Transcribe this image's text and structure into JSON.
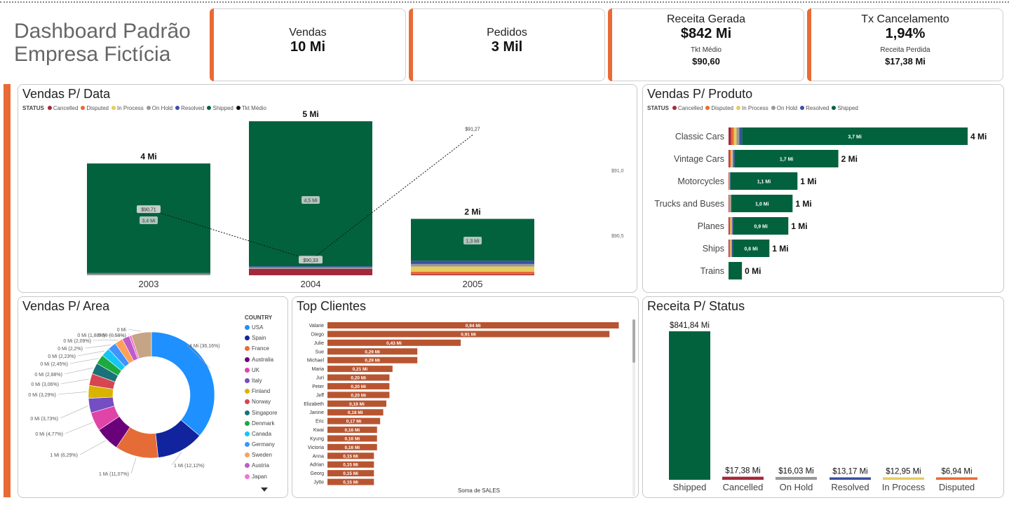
{
  "header": {
    "title_line1": "Dashboard Padrão",
    "title_line2": "Empresa Fictícia"
  },
  "kpis": {
    "vendas": {
      "label": "Vendas",
      "value": "10 Mi"
    },
    "pedidos": {
      "label": "Pedidos",
      "value": "3 Mil"
    },
    "receita": {
      "label": "Receita Gerada",
      "value": "$842 Mi",
      "sub_label": "Tkt Médio",
      "sub_value": "$90,60"
    },
    "cancel": {
      "label": "Tx Cancelamento",
      "value": "1,94%",
      "sub_label": "Receita Perdida",
      "sub_value": "$17,38 Mi"
    }
  },
  "colors": {
    "accent": "#e96a35",
    "Cancelled": "#a4283b",
    "Disputed": "#e96a35",
    "In Process": "#e6cc5c",
    "On Hold": "#999999",
    "Resolved": "#3a50a4",
    "Shipped": "#03623e",
    "Tkt Médio": "#111111",
    "clientes_bar": "#b85531"
  },
  "legend_status": {
    "title": "STATUS",
    "items": [
      "Cancelled",
      "Disputed",
      "In Process",
      "On Hold",
      "Resolved",
      "Shipped",
      "Tkt Médio"
    ]
  },
  "chart_data": [
    {
      "id": "vendas_data",
      "type": "bar",
      "title": "Vendas P/ Data",
      "categories": [
        "2003",
        "2004",
        "2005"
      ],
      "totals_labels": [
        "4 Mi",
        "5 Mi",
        "2 Mi"
      ],
      "shipped_labels": [
        "3,4 Mi",
        "4,5 Mi",
        "1,3 Mi"
      ],
      "stacked": true,
      "series": [
        {
          "name": "Cancelled",
          "values": [
            0.0,
            0.2,
            0.03
          ]
        },
        {
          "name": "Disputed",
          "values": [
            0.0,
            0.0,
            0.08
          ]
        },
        {
          "name": "In Process",
          "values": [
            0.0,
            0.0,
            0.16
          ]
        },
        {
          "name": "On Hold",
          "values": [
            0.05,
            0.05,
            0.08
          ]
        },
        {
          "name": "Resolved",
          "values": [
            0.02,
            0.03,
            0.1
          ]
        },
        {
          "name": "Shipped",
          "values": [
            3.4,
            4.5,
            1.3
          ]
        }
      ],
      "line": {
        "name": "Tkt Médio",
        "values": [
          90.71,
          90.33,
          91.27
        ],
        "labels": [
          "$90,71",
          "$90,33",
          "$91,27"
        ]
      },
      "y2_ticks": [
        "$91,0",
        "$90,5"
      ]
    },
    {
      "id": "vendas_produto",
      "type": "bar",
      "orientation": "horizontal",
      "title": "Vendas P/ Produto",
      "categories": [
        "Classic Cars",
        "Vintage Cars",
        "Motorcycles",
        "Trucks and Buses",
        "Planes",
        "Ships",
        "Trains"
      ],
      "totals_labels": [
        "4 Mi",
        "2 Mi",
        "1 Mi",
        "1 Mi",
        "1 Mi",
        "1 Mi",
        "0 Mi"
      ],
      "shipped_values": [
        3.7,
        1.7,
        1.1,
        1.0,
        0.9,
        0.6,
        0.22
      ],
      "shipped_labels": [
        "3,7 Mi",
        "1,7 Mi",
        "1,1 Mi",
        "1,0 Mi",
        "0,9 Mi",
        "0,6 Mi",
        ""
      ],
      "other_values": [
        0.22,
        0.1,
        0.03,
        0.05,
        0.08,
        0.07,
        0.0
      ]
    },
    {
      "id": "vendas_area",
      "type": "pie",
      "title": "Vendas P/ Area",
      "legend_title": "COUNTRY",
      "legend": [
        "USA",
        "Spain",
        "France",
        "Australia",
        "UK",
        "Italy",
        "Finland",
        "Norway",
        "Singapore",
        "Denmark",
        "Canada",
        "Germany",
        "Sweden",
        "Austria",
        "Japan"
      ],
      "slices": [
        {
          "name": "USA",
          "value": 36.16,
          "label": "4 Mi (36,16%)",
          "color": "#1e90ff"
        },
        {
          "name": "Spain",
          "value": 12.12,
          "label": "1 Mi (12,12%)",
          "color": "#12239e"
        },
        {
          "name": "France",
          "value": 11.07,
          "label": "1 Mi (11,07%)",
          "color": "#e66c37"
        },
        {
          "name": "Australia",
          "value": 6.29,
          "label": "1 Mi (6,29%)",
          "color": "#6b007b"
        },
        {
          "name": "UK",
          "value": 4.77,
          "label": "0 Mi (4,77%)",
          "color": "#e044a7"
        },
        {
          "name": "Italy",
          "value": 3.73,
          "label": "0 Mi (3,73%)",
          "color": "#744ec2"
        },
        {
          "name": "Finland",
          "value": 3.29,
          "label": "0 Mi (3,29%)",
          "color": "#d9b300"
        },
        {
          "name": "Norway",
          "value": 3.06,
          "label": "0 Mi (3,06%)",
          "color": "#d64550"
        },
        {
          "name": "Singapore",
          "value": 2.88,
          "label": "0 Mi (2,88%)",
          "color": "#197278"
        },
        {
          "name": "Denmark",
          "value": 2.45,
          "label": "0 Mi (2,45%)",
          "color": "#1aab40"
        },
        {
          "name": "Canada",
          "value": 2.23,
          "label": "0 Mi (2,23%)",
          "color": "#15c6f4"
        },
        {
          "name": "Germany",
          "value": 2.2,
          "label": "0 Mi (2,2%)",
          "color": "#4092ff"
        },
        {
          "name": "Sweden",
          "value": 2.09,
          "label": "0 Mi (2,09%)",
          "color": "#ffa058"
        },
        {
          "name": "Austria",
          "value": 1.88,
          "label": "0 Mi (1,88%)",
          "color": "#be5dc9"
        },
        {
          "name": "Japan",
          "value": 0.58,
          "label": "0 Mi (0,58%)",
          "color": "#f472d0"
        },
        {
          "name": "Others",
          "value": 5.17,
          "label": "0 Mi",
          "color": "#c5a586"
        }
      ]
    },
    {
      "id": "top_clientes",
      "type": "bar",
      "orientation": "horizontal",
      "title": "Top Clientes",
      "xlabel": "Soma de SALES",
      "categories": [
        "Valarie",
        "Diego",
        "Julie",
        "Sue",
        "Michael",
        "Maria",
        "Juri",
        "Peter",
        "Jeff",
        "Elizabeth",
        "Janine",
        "Eric",
        "Kwai",
        "Kyung",
        "Victoria",
        "Anna",
        "Adrian",
        "Georg",
        "Jytte"
      ],
      "values": [
        0.94,
        0.91,
        0.43,
        0.29,
        0.29,
        0.21,
        0.2,
        0.2,
        0.2,
        0.19,
        0.18,
        0.17,
        0.16,
        0.16,
        0.16,
        0.15,
        0.15,
        0.15,
        0.15
      ],
      "labels": [
        "0,94 Mi",
        "0,91 Mi",
        "0,43 Mi",
        "0,29 Mi",
        "0,29 Mi",
        "0,21 Mi",
        "0,20 Mi",
        "0,20 Mi",
        "0,20 Mi",
        "0,19 Mi",
        "0,18 Mi",
        "0,17 Mi",
        "0,16 Mi",
        "0,16 Mi",
        "0,16 Mi",
        "0,15 Mi",
        "0,15 Mi",
        "0,15 Mi",
        "0,15 Mi"
      ]
    },
    {
      "id": "receita_status",
      "type": "bar",
      "title": "Receita P/ Status",
      "categories": [
        "Shipped",
        "Cancelled",
        "On Hold",
        "Resolved",
        "In Process",
        "Disputed"
      ],
      "values": [
        841.84,
        17.38,
        16.03,
        13.17,
        12.95,
        6.94
      ],
      "labels": [
        "$841,84 Mi",
        "$17,38 Mi",
        "$16,03 Mi",
        "$13,17 Mi",
        "$12,95 Mi",
        "$6,94 Mi"
      ]
    }
  ]
}
